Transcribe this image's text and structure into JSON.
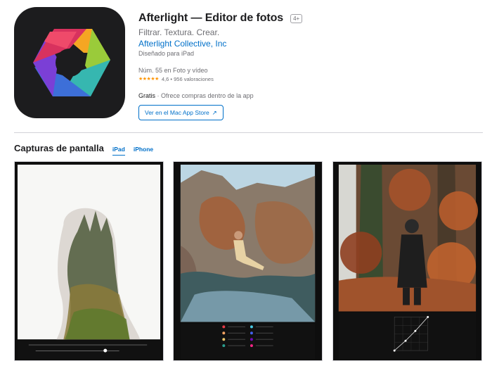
{
  "app": {
    "title": "Afterlight — Editor de fotos",
    "age_rating": "4+",
    "subtitle": "Filtrar. Textura. Crear.",
    "developer": "Afterlight Collective, Inc",
    "designed_for": "Diseñado para iPad",
    "rank": "Núm. 55 en Foto y vídeo",
    "rating_stars": "★★★★★",
    "rating_text": "4,6 • 956 valoraciones",
    "price": "Gratis",
    "in_app": "· Ofrece compras dentro de la app",
    "mac_button_label": "Ver en el Mac App Store",
    "mac_button_icon": "↗",
    "icon_name": "aperture-logo-icon",
    "colors": {
      "accent": "#0070c9",
      "icon_background": "#1c1c1e",
      "star": "#ff9500"
    }
  },
  "screenshots": {
    "title": "Capturas de pantalla",
    "tabs": [
      {
        "label": "iPad",
        "active": true
      },
      {
        "label": "iPhone",
        "active": false
      }
    ]
  }
}
